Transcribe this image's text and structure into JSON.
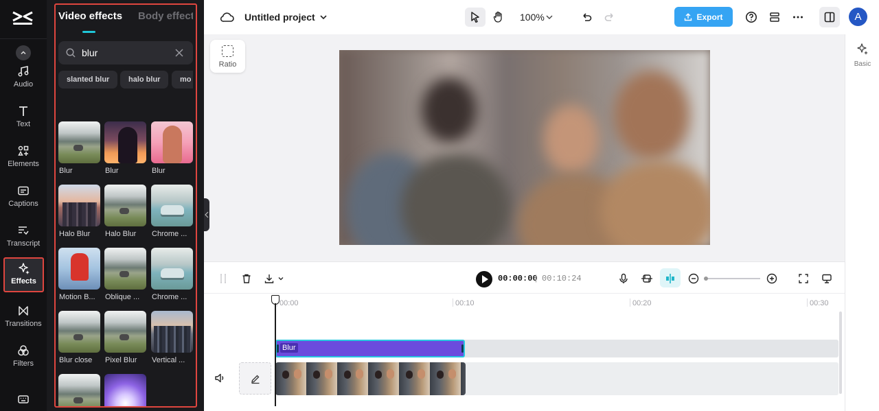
{
  "rail": {
    "items": [
      {
        "label": "Audio",
        "icon": "music-note-icon"
      },
      {
        "label": "Text",
        "icon": "text-icon"
      },
      {
        "label": "Elements",
        "icon": "elements-icon"
      },
      {
        "label": "Captions",
        "icon": "captions-icon"
      },
      {
        "label": "Transcript",
        "icon": "transcript-icon"
      },
      {
        "label": "Effects",
        "icon": "sparkle-icon",
        "active": true
      },
      {
        "label": "Transitions",
        "icon": "transitions-icon"
      },
      {
        "label": "Filters",
        "icon": "filters-icon"
      }
    ]
  },
  "panel": {
    "tabs": [
      "Video effects",
      "Body effects"
    ],
    "active_tab": "Video effects",
    "search": {
      "value": "blur"
    },
    "chips": [
      "slanted blur",
      "halo blur",
      "mo"
    ],
    "effects": [
      {
        "label": "Blur",
        "thumb": "t-mist"
      },
      {
        "label": "Blur",
        "thumb": "t-sunset"
      },
      {
        "label": "Blur",
        "thumb": "t-pink"
      },
      {
        "label": "Halo Blur",
        "thumb": "t-city"
      },
      {
        "label": "Halo Blur",
        "thumb": "t-mist"
      },
      {
        "label": "Chrome ...",
        "thumb": "t-car"
      },
      {
        "label": "Motion B...",
        "thumb": "t-motion"
      },
      {
        "label": "Oblique ...",
        "thumb": "t-mist"
      },
      {
        "label": "Chrome ...",
        "thumb": "t-car"
      },
      {
        "label": "Blur close",
        "thumb": "t-mist"
      },
      {
        "label": "Pixel Blur",
        "thumb": "t-mist"
      },
      {
        "label": "Vertical ...",
        "thumb": "t-vert"
      },
      {
        "label": "",
        "thumb": "t-mist"
      },
      {
        "label": "",
        "thumb": "t-glow"
      }
    ]
  },
  "topbar": {
    "project_title": "Untitled project",
    "zoom": "100%",
    "export_label": "Export",
    "avatar_initial": "A"
  },
  "canvas": {
    "ratio_label": "Ratio"
  },
  "right_panel": {
    "basic_label": "Basic"
  },
  "timeline": {
    "current_time": "00:00:00",
    "separator": "|",
    "duration": "00:10:24",
    "ruler_ticks": [
      "00:00",
      "00:10",
      "00:20",
      "00:30"
    ],
    "effect_clip_label": "Blur",
    "accent_color": "#27c7e0",
    "effect_clip_color": "#6b4bdd"
  }
}
